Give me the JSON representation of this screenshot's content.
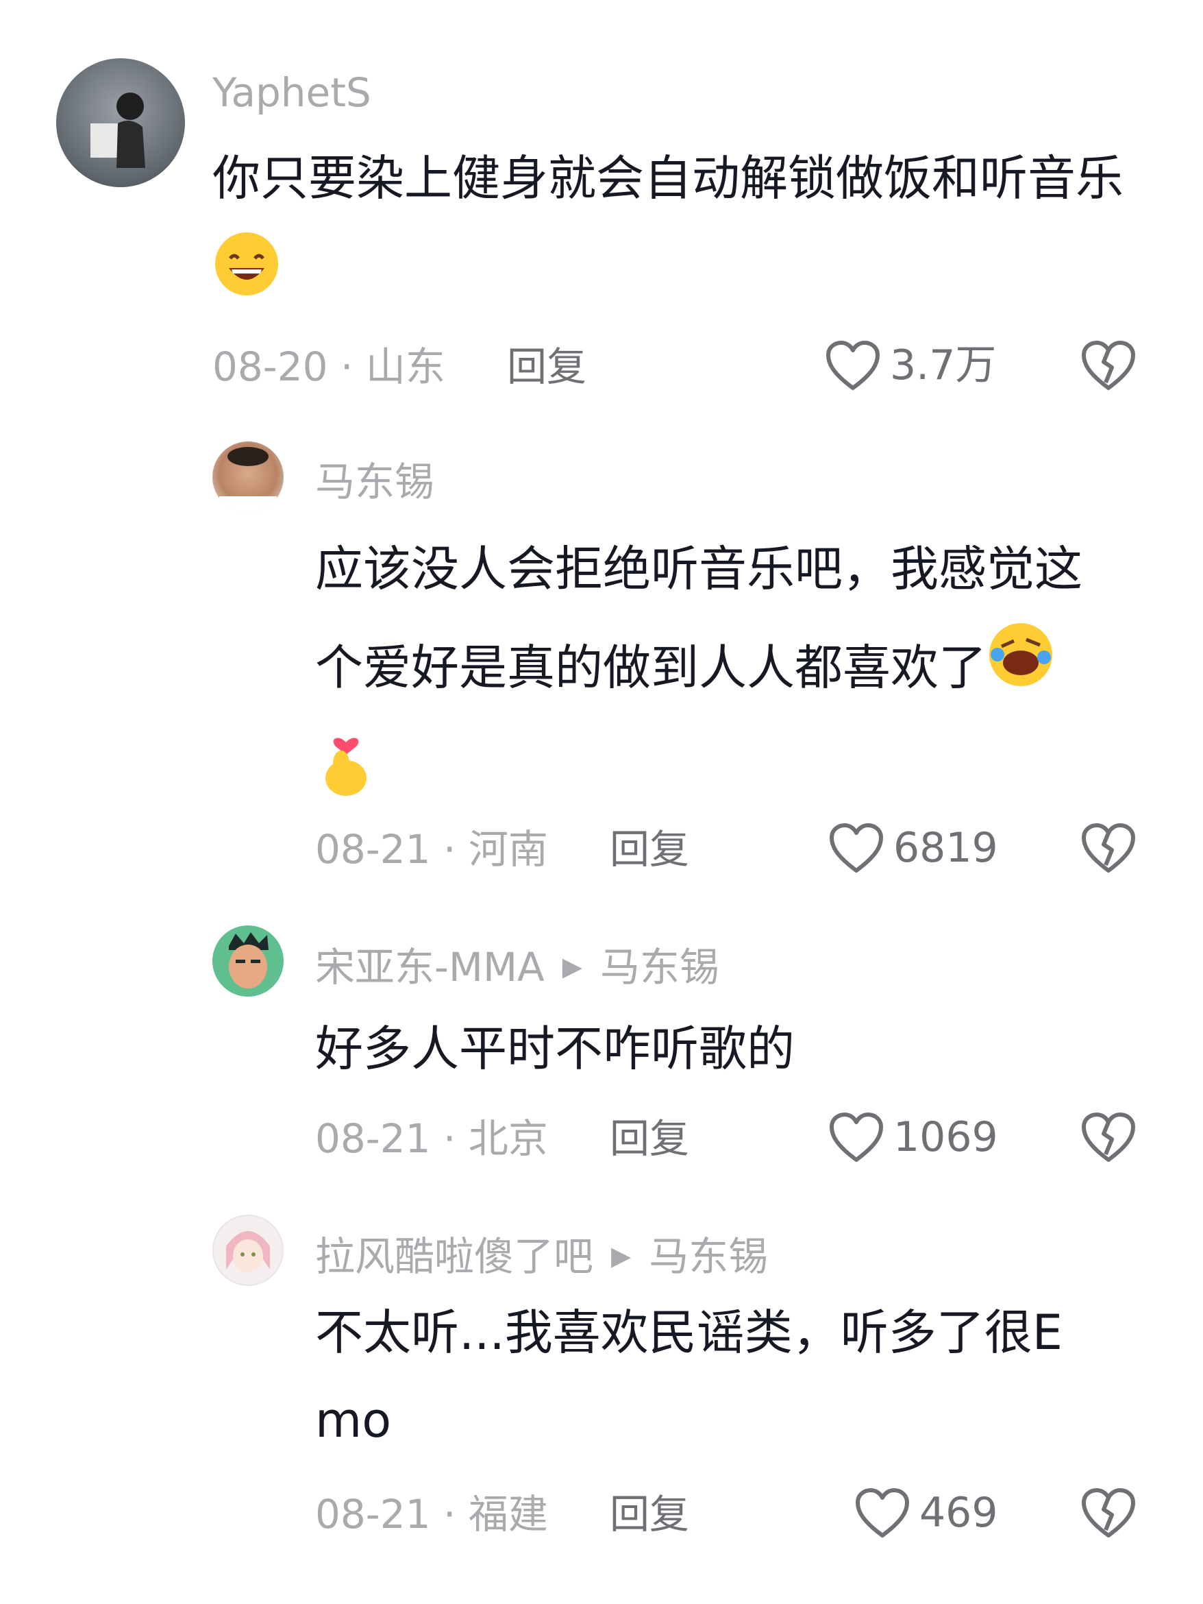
{
  "comments": [
    {
      "username": "YaphetS",
      "text": "你只要染上健身就会自动解锁做饭和听音乐",
      "emoji": "grinning-face",
      "date": "08-20",
      "location": "山东",
      "reply_label": "回复",
      "likes": "3.7万"
    },
    {
      "username": "马东锡",
      "text": "应该没人会拒绝听音乐吧，我感觉这个爱好是真的做到人人都喜欢了",
      "emoji": "rolling-laughing-face + finger-heart",
      "date": "08-21",
      "location": "河南",
      "reply_label": "回复",
      "likes": "6819"
    },
    {
      "username": "宋亚东-MMA",
      "reply_to": "马东锡",
      "text": "好多人平时不咋听歌的",
      "date": "08-21",
      "location": "北京",
      "reply_label": "回复",
      "likes": "1069"
    },
    {
      "username": "拉风酷啦傻了吧",
      "reply_to": "马东锡",
      "text": "不太听...我喜欢民谣类，听多了很Emo",
      "date": "08-21",
      "location": "福建",
      "reply_label": "回复",
      "likes": "469"
    }
  ],
  "separator": "·",
  "icons": {
    "like": "heart-outline-icon",
    "dislike": "broken-heart-icon",
    "reply_arrow": "triangle-right-icon"
  },
  "colors": {
    "text": "#161823",
    "muted": "#a9aaae",
    "secondary": "#6f7075"
  }
}
